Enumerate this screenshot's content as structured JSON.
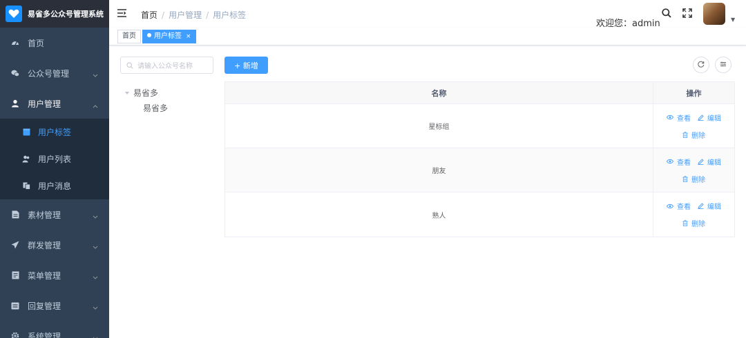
{
  "app": {
    "title": "易省多公众号管理系统"
  },
  "sidebar": {
    "items": [
      {
        "label": "首页",
        "icon": "dashboard-icon"
      },
      {
        "label": "公众号管理",
        "icon": "wechat-icon"
      },
      {
        "label": "用户管理",
        "icon": "user-icon",
        "open": true,
        "children": [
          {
            "label": "用户标签",
            "icon": "tag-icon",
            "active": true
          },
          {
            "label": "用户列表",
            "icon": "peoples-icon"
          },
          {
            "label": "用户消息",
            "icon": "message-icon"
          }
        ]
      },
      {
        "label": "素材管理",
        "icon": "document-icon"
      },
      {
        "label": "群发管理",
        "icon": "send-icon"
      },
      {
        "label": "菜单管理",
        "icon": "menu-doc-icon"
      },
      {
        "label": "回复管理",
        "icon": "reply-icon"
      },
      {
        "label": "系统管理",
        "icon": "settings-icon"
      }
    ]
  },
  "header": {
    "breadcrumb": [
      "首页",
      "用户管理",
      "用户标签"
    ],
    "welcome": "欢迎您：admin"
  },
  "tags_view": {
    "tabs": [
      {
        "label": "首页",
        "active": false
      },
      {
        "label": "用户标签",
        "active": true,
        "close": "×"
      }
    ]
  },
  "tree": {
    "search_placeholder": "请输入公众号名称",
    "root": "易省多",
    "child": "易省多"
  },
  "toolbar": {
    "add_label": "+ 新增"
  },
  "table": {
    "headers": {
      "name": "名称",
      "actions": "操作"
    },
    "rows": [
      {
        "name": "星标组"
      },
      {
        "name": "朋友"
      },
      {
        "name": "熟人"
      }
    ],
    "actions": {
      "view": "查看",
      "edit": "编辑",
      "delete": "删除"
    }
  },
  "colors": {
    "primary": "#409eff",
    "sidebar_bg": "#304156",
    "submenu_bg": "#1f2d3d",
    "logo_bg": "#2b2f3a"
  }
}
